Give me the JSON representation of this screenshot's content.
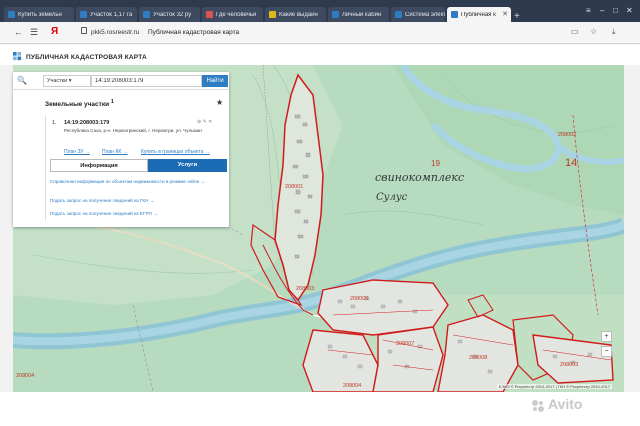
{
  "browser": {
    "tabs": [
      {
        "title": "Купить земельн",
        "color": "#2e7dc2",
        "active": false
      },
      {
        "title": "Участок 1,17 га",
        "color": "#2e7dc2",
        "active": false
      },
      {
        "title": "Участок 32 ру",
        "color": "#2e7dc2",
        "active": false
      },
      {
        "title": "Где человечьи",
        "color": "#d9534f",
        "active": false
      },
      {
        "title": "Какие выдайн",
        "color": "#e0b81a",
        "active": false
      },
      {
        "title": "Личный кабин",
        "color": "#2e7dc2",
        "active": false
      },
      {
        "title": "Система элект",
        "color": "#2e7dc2",
        "active": false
      },
      {
        "title": "Публичная к",
        "color": "#2e7dc2",
        "active": true
      }
    ],
    "new_tab": "+",
    "url": "pkk5.rosreestr.ru",
    "page_title": "Публичная кадастровая карта",
    "browser_logo": "Я"
  },
  "site": {
    "title": "ПУБЛИЧНАЯ КАДАСТРОВАЯ КАРТА",
    "logo_color": "#2e7dc2"
  },
  "search": {
    "type_label": "Участки",
    "query": "14:19:208003:179",
    "button_label": "Найти"
  },
  "results": {
    "header": "Земельные участки",
    "header_count": "1",
    "item_number": "1.",
    "cad_number": "14:19:208003:179",
    "address": "Республика Саха, р-н. Нерюнгринский, г. Нерюнгри, ул. Чульман",
    "links": [
      "План ЗУ →",
      "План КК →",
      "Купить в границах объекта →"
    ],
    "tabs": {
      "info": "Информация",
      "services": "Услуги"
    },
    "services": [
      "Справочная информация по объектам недвижимости в режиме online →",
      "Подать запрос на получение сведений из ГКН →",
      "Подать запрос на получение сведений из ЕГРП →"
    ]
  },
  "map": {
    "labels": {
      "l1": "208002",
      "l2": "19",
      "l3": "14",
      "l4": "свинокомплекс",
      "l5": "Сулус",
      "l6": "208001",
      "l7": "208003",
      "l8": "208005",
      "l9": "208004",
      "l10": "208007",
      "l11": "208008",
      "l12": "208004",
      "l13": "208003"
    },
    "copyright": "ЕЭКО © Росреестр 2010-2017 | ГКН © Росреестр 2010-2017"
  },
  "watermark": "Avito"
}
